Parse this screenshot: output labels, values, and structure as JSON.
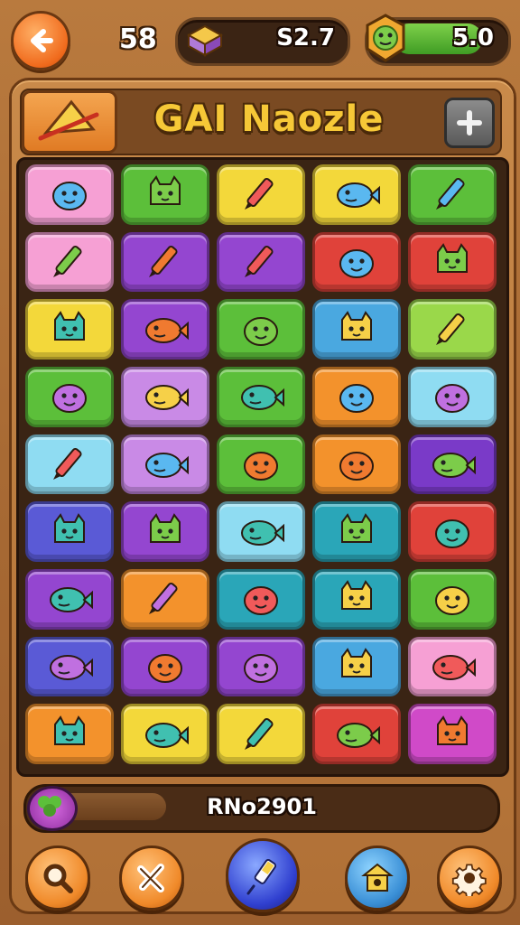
{
  "header": {
    "level": "58",
    "score": "S2.7",
    "energy": "5.0",
    "energy_fraction": 0.78
  },
  "title": "GAI Naozle",
  "progress": {
    "label": "RNo2901",
    "fraction": 0.3
  },
  "colors": {
    "pink": "#f6a0d4",
    "green": "#5cbf3a",
    "yellow": "#f3d83a",
    "purple": "#9446d0",
    "red": "#e0423a",
    "orange": "#f3922c",
    "blue": "#4aa8e0",
    "lightblue": "#8fdcf2",
    "teal": "#2aa6b8",
    "indigo": "#5a5ad6",
    "magenta": "#d04ac8",
    "lilac": "#c98ae6",
    "lime": "#9ad84a",
    "violet": "#7a3ac8"
  },
  "tiles": [
    {
      "color": "#f6a0d4",
      "icon": "pencil-icon"
    },
    {
      "color": "#5cbf3a",
      "icon": "beetle-icon"
    },
    {
      "color": "#f3d83a",
      "icon": "shield-icon"
    },
    {
      "color": "#f3d83a",
      "icon": "goblin-icon"
    },
    {
      "color": "#5cbf3a",
      "icon": "striped-ball-icon"
    },
    {
      "color": "#f6a0d4",
      "icon": "sun-icon"
    },
    {
      "color": "#9446d0",
      "icon": "cat-face-icon"
    },
    {
      "color": "#9446d0",
      "icon": "whale-icon"
    },
    {
      "color": "#e0423a",
      "icon": "planet-icon"
    },
    {
      "color": "#e0423a",
      "icon": "ufo-icon"
    },
    {
      "color": "#f3d83a",
      "icon": "crab-icon"
    },
    {
      "color": "#9446d0",
      "icon": "alien-icon"
    },
    {
      "color": "#5cbf3a",
      "icon": "chick-icon"
    },
    {
      "color": "#4aa8e0",
      "icon": "ship-icon"
    },
    {
      "color": "#9ad84a",
      "icon": "turtle-icon"
    },
    {
      "color": "#5cbf3a",
      "icon": "frog-icon"
    },
    {
      "color": "#c98ae6",
      "icon": "pig-icon"
    },
    {
      "color": "#5cbf3a",
      "icon": "glider-icon"
    },
    {
      "color": "#f3922c",
      "icon": "robot-icon"
    },
    {
      "color": "#8fdcf2",
      "icon": "boat-icon"
    },
    {
      "color": "#8fdcf2",
      "icon": "owl-icon"
    },
    {
      "color": "#c98ae6",
      "icon": "bug-icon"
    },
    {
      "color": "#5cbf3a",
      "icon": "dino-icon"
    },
    {
      "color": "#f3922c",
      "icon": "mask-icon"
    },
    {
      "color": "#7a3ac8",
      "icon": "slime-icon"
    },
    {
      "color": "#5a5ad6",
      "icon": "blob-icon"
    },
    {
      "color": "#9446d0",
      "icon": "crayon-icon"
    },
    {
      "color": "#8fdcf2",
      "icon": "feather-icon"
    },
    {
      "color": "#2aa6b8",
      "icon": "spider-icon"
    },
    {
      "color": "#e0423a",
      "icon": "brush-icon"
    },
    {
      "color": "#9446d0",
      "icon": "fish-icon"
    },
    {
      "color": "#f3922c",
      "icon": "card-icon"
    },
    {
      "color": "#2aa6b8",
      "icon": "fox-icon"
    },
    {
      "color": "#2aa6b8",
      "icon": "monster-icon"
    },
    {
      "color": "#5cbf3a",
      "icon": "bowl-icon"
    },
    {
      "color": "#5a5ad6",
      "icon": "smiley-icon"
    },
    {
      "color": "#9446d0",
      "icon": "tiger-icon"
    },
    {
      "color": "#9446d0",
      "icon": "shark-icon"
    },
    {
      "color": "#4aa8e0",
      "icon": "marker-icon"
    },
    {
      "color": "#f6a0d4",
      "icon": "bomb-icon"
    },
    {
      "color": "#f3922c",
      "icon": "candy-icon"
    },
    {
      "color": "#f3d83a",
      "icon": "owl-face-icon"
    },
    {
      "color": "#f3d83a",
      "icon": "piranha-icon"
    },
    {
      "color": "#e0423a",
      "icon": "dog-icon"
    },
    {
      "color": "#d04ac8",
      "icon": "envelope-icon"
    }
  ]
}
